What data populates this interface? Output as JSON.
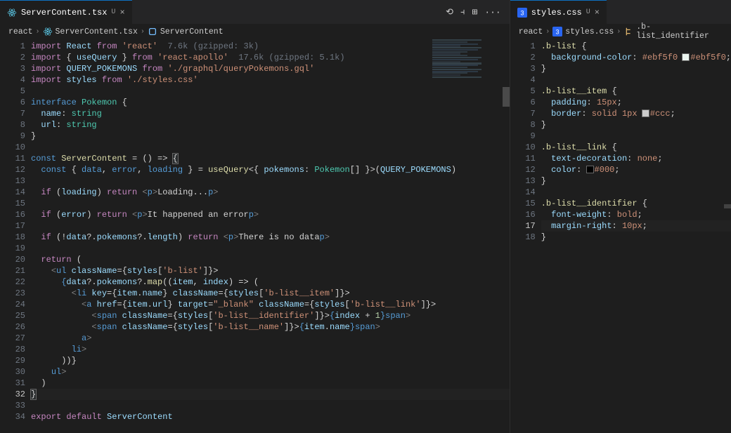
{
  "left": {
    "tab": {
      "name": "ServerContent.tsx",
      "dirty": "U"
    },
    "breadcrumbs": [
      "react",
      "ServerContent.tsx",
      "ServerContent"
    ],
    "line_count": 34,
    "active_line": 32,
    "code_tokens": {
      "l1": {
        "import": "import",
        "React": "React",
        "from": "from",
        "str": "'react'",
        "note": "7.6k (gzipped: 3k)"
      },
      "l2": {
        "import": "import",
        "lb": "{ ",
        "useQuery": "useQuery",
        "rb": " }",
        "from": "from",
        "str": "'react-apollo'",
        "note": "17.6k (gzipped: 5.1k)"
      },
      "l3": {
        "import": "import",
        "QUERY_POKEMONS": "QUERY_POKEMONS",
        "from": "from",
        "str": "'./graphql/queryPokemons.gql'"
      },
      "l4": {
        "import": "import",
        "styles": "styles",
        "from": "from",
        "str": "'./styles.css'"
      },
      "l6": {
        "interface": "interface",
        "Pokemon": "Pokemon",
        "lb": " {"
      },
      "l7": {
        "name": "name",
        "col": ": ",
        "string": "string"
      },
      "l8": {
        "url": "url",
        "col": ": ",
        "string": "string"
      },
      "l9": {
        "rb": "}"
      },
      "l11": {
        "const": "const",
        "ServerContent": "ServerContent",
        "eq": " = () => ",
        "lb": "{"
      },
      "l12": {
        "const": "const",
        "lb2": " { ",
        "data": "data",
        "error": "error",
        "loading": "loading",
        "rb2": " } = ",
        "useQuery": "useQuery",
        "lt": "<{ ",
        "pokemons": "pokemons",
        "col": ": ",
        "Pokemon": "Pokemon",
        "arr": "[] }",
        "gt": ">(",
        "QUERY_POKEMONS": "QUERY_POKEMONS",
        "end": ")"
      },
      "l14": {
        "if": "if",
        "cond": " (",
        "loading": "loading",
        "cp": ") ",
        "return": "return",
        "lt": " <",
        "p": "p",
        "gt": ">",
        "txt": "Loading...",
        "ct": "</",
        "p2": "p",
        "cg": ">"
      },
      "l16": {
        "if": "if",
        "cond": " (",
        "error": "error",
        "cp": ") ",
        "return": "return",
        "lt": " <",
        "p": "p",
        "gt": ">",
        "txt": "It happened an error",
        "ct": "</",
        "p2": "p",
        "cg": ">"
      },
      "l18": {
        "if": "if",
        "cond": " (!",
        "data": "data",
        "q1": "?.",
        "pokemons": "pokemons",
        "q2": "?.",
        "length": "length",
        "cp": ") ",
        "return": "return",
        "lt": " <",
        "p": "p",
        "gt": ">",
        "txt": "There is no data",
        "ct": "</",
        "p2": "p",
        "cg": ">"
      },
      "l20": {
        "return": "return",
        "p": " ("
      },
      "l21": {
        "lt": "<",
        "ul": "ul",
        "className": "className",
        "eq": "={",
        "styles": "styles",
        "br": "[",
        "str": "'b-list'",
        "end": "]}>",
        "gt": ""
      },
      "l22": {
        "lb": "{",
        "data": "data",
        "q1": "?.",
        "pokemons": "pokemons",
        "q2": "?.",
        "map": "map",
        "p": "((",
        "item": "item",
        "c": ", ",
        "index": "index",
        "cp": ") => ("
      },
      "l23": {
        "lt": "<",
        "li": "li",
        "key": "key",
        "eq": "={",
        "item": "item",
        "dot": ".",
        "name": "name",
        "cb": "}",
        "sp": " ",
        "className": "className",
        "eq2": "={",
        "styles": "styles",
        "br": "[",
        "str": "'b-list__item'",
        "end": "]}>"
      },
      "l24": {
        "lt": "<",
        "a": "a",
        "href": "href",
        "eq": "={",
        "item": "item",
        "dot": ".",
        "url": "url",
        "cb": "}",
        "sp": " ",
        "target": "target",
        "eq2": "=",
        "str": "\"_blank\"",
        "sp2": " ",
        "className": "className",
        "eq3": "={",
        "styles": "styles",
        "br": "[",
        "str2": "'b-list__link'",
        "end": "]}>"
      },
      "l25": {
        "lt": "<",
        "span": "span",
        "className": "className",
        "eq": "={",
        "styles": "styles",
        "br": "[",
        "str": "'b-list__identifier'",
        "end": "]}>",
        "lb": "{",
        "index": "index",
        "plus": " + ",
        "one": "1",
        "rb": "}",
        "ct": "</",
        "span2": "span",
        "cg": ">"
      },
      "l26": {
        "lt": "<",
        "span": "span",
        "className": "className",
        "eq": "={",
        "styles": "styles",
        "br": "[",
        "str": "'b-list__name'",
        "end": "]}>",
        "lb": "{",
        "item": "item",
        "dot": ".",
        "name": "name",
        "rb": "}",
        "ct": "</",
        "span2": "span",
        "cg": ">"
      },
      "l27": {
        "ct": "</",
        "a": "a",
        "cg": ">"
      },
      "l28": {
        "ct": "</",
        "li": "li",
        "cg": ">"
      },
      "l29": {
        "rb": "))}"
      },
      "l30": {
        "ct": "</",
        "ul": "ul",
        "cg": ">"
      },
      "l31": {
        "rb": ")"
      },
      "l32": {
        "rb": "}"
      },
      "l34": {
        "export": "export",
        "default": "default",
        "ServerContent": "ServerContent"
      }
    }
  },
  "right": {
    "tab": {
      "name": "styles.css",
      "dirty": "U"
    },
    "breadcrumbs": [
      "react",
      "styles.css",
      ".b-list_identifier"
    ],
    "line_count": 18,
    "active_line": 17,
    "code": {
      "l1": {
        "sel": ".b-list",
        "lb": " {"
      },
      "l2": {
        "prop": "background-color",
        "val": "#ebf5f0",
        "hex": "#ebf5f0"
      },
      "l3": {
        "rb": "}"
      },
      "l5": {
        "sel": ".b-list__item",
        "lb": " {"
      },
      "l6": {
        "prop": "padding",
        "val": "15px"
      },
      "l7": {
        "prop": "border",
        "val": "solid 1px",
        "hex": "#ccc",
        "hexlabel": "#ccc"
      },
      "l8": {
        "rb": "}"
      },
      "l10": {
        "sel": ".b-list__link",
        "lb": " {"
      },
      "l11": {
        "prop": "text-decoration",
        "val": "none"
      },
      "l12": {
        "prop": "color",
        "hex": "#000",
        "hexlabel": "#000"
      },
      "l13": {
        "rb": "}"
      },
      "l15": {
        "sel": ".b-list__identifier",
        "lb": " {"
      },
      "l16": {
        "prop": "font-weight",
        "val": "bold"
      },
      "l17": {
        "prop": "margin-right",
        "val": "10px"
      },
      "l18": {
        "rb": "}"
      }
    }
  },
  "icons": {
    "history": "⟲",
    "splitv": "⫞",
    "splith": "⊞",
    "more": "···"
  }
}
